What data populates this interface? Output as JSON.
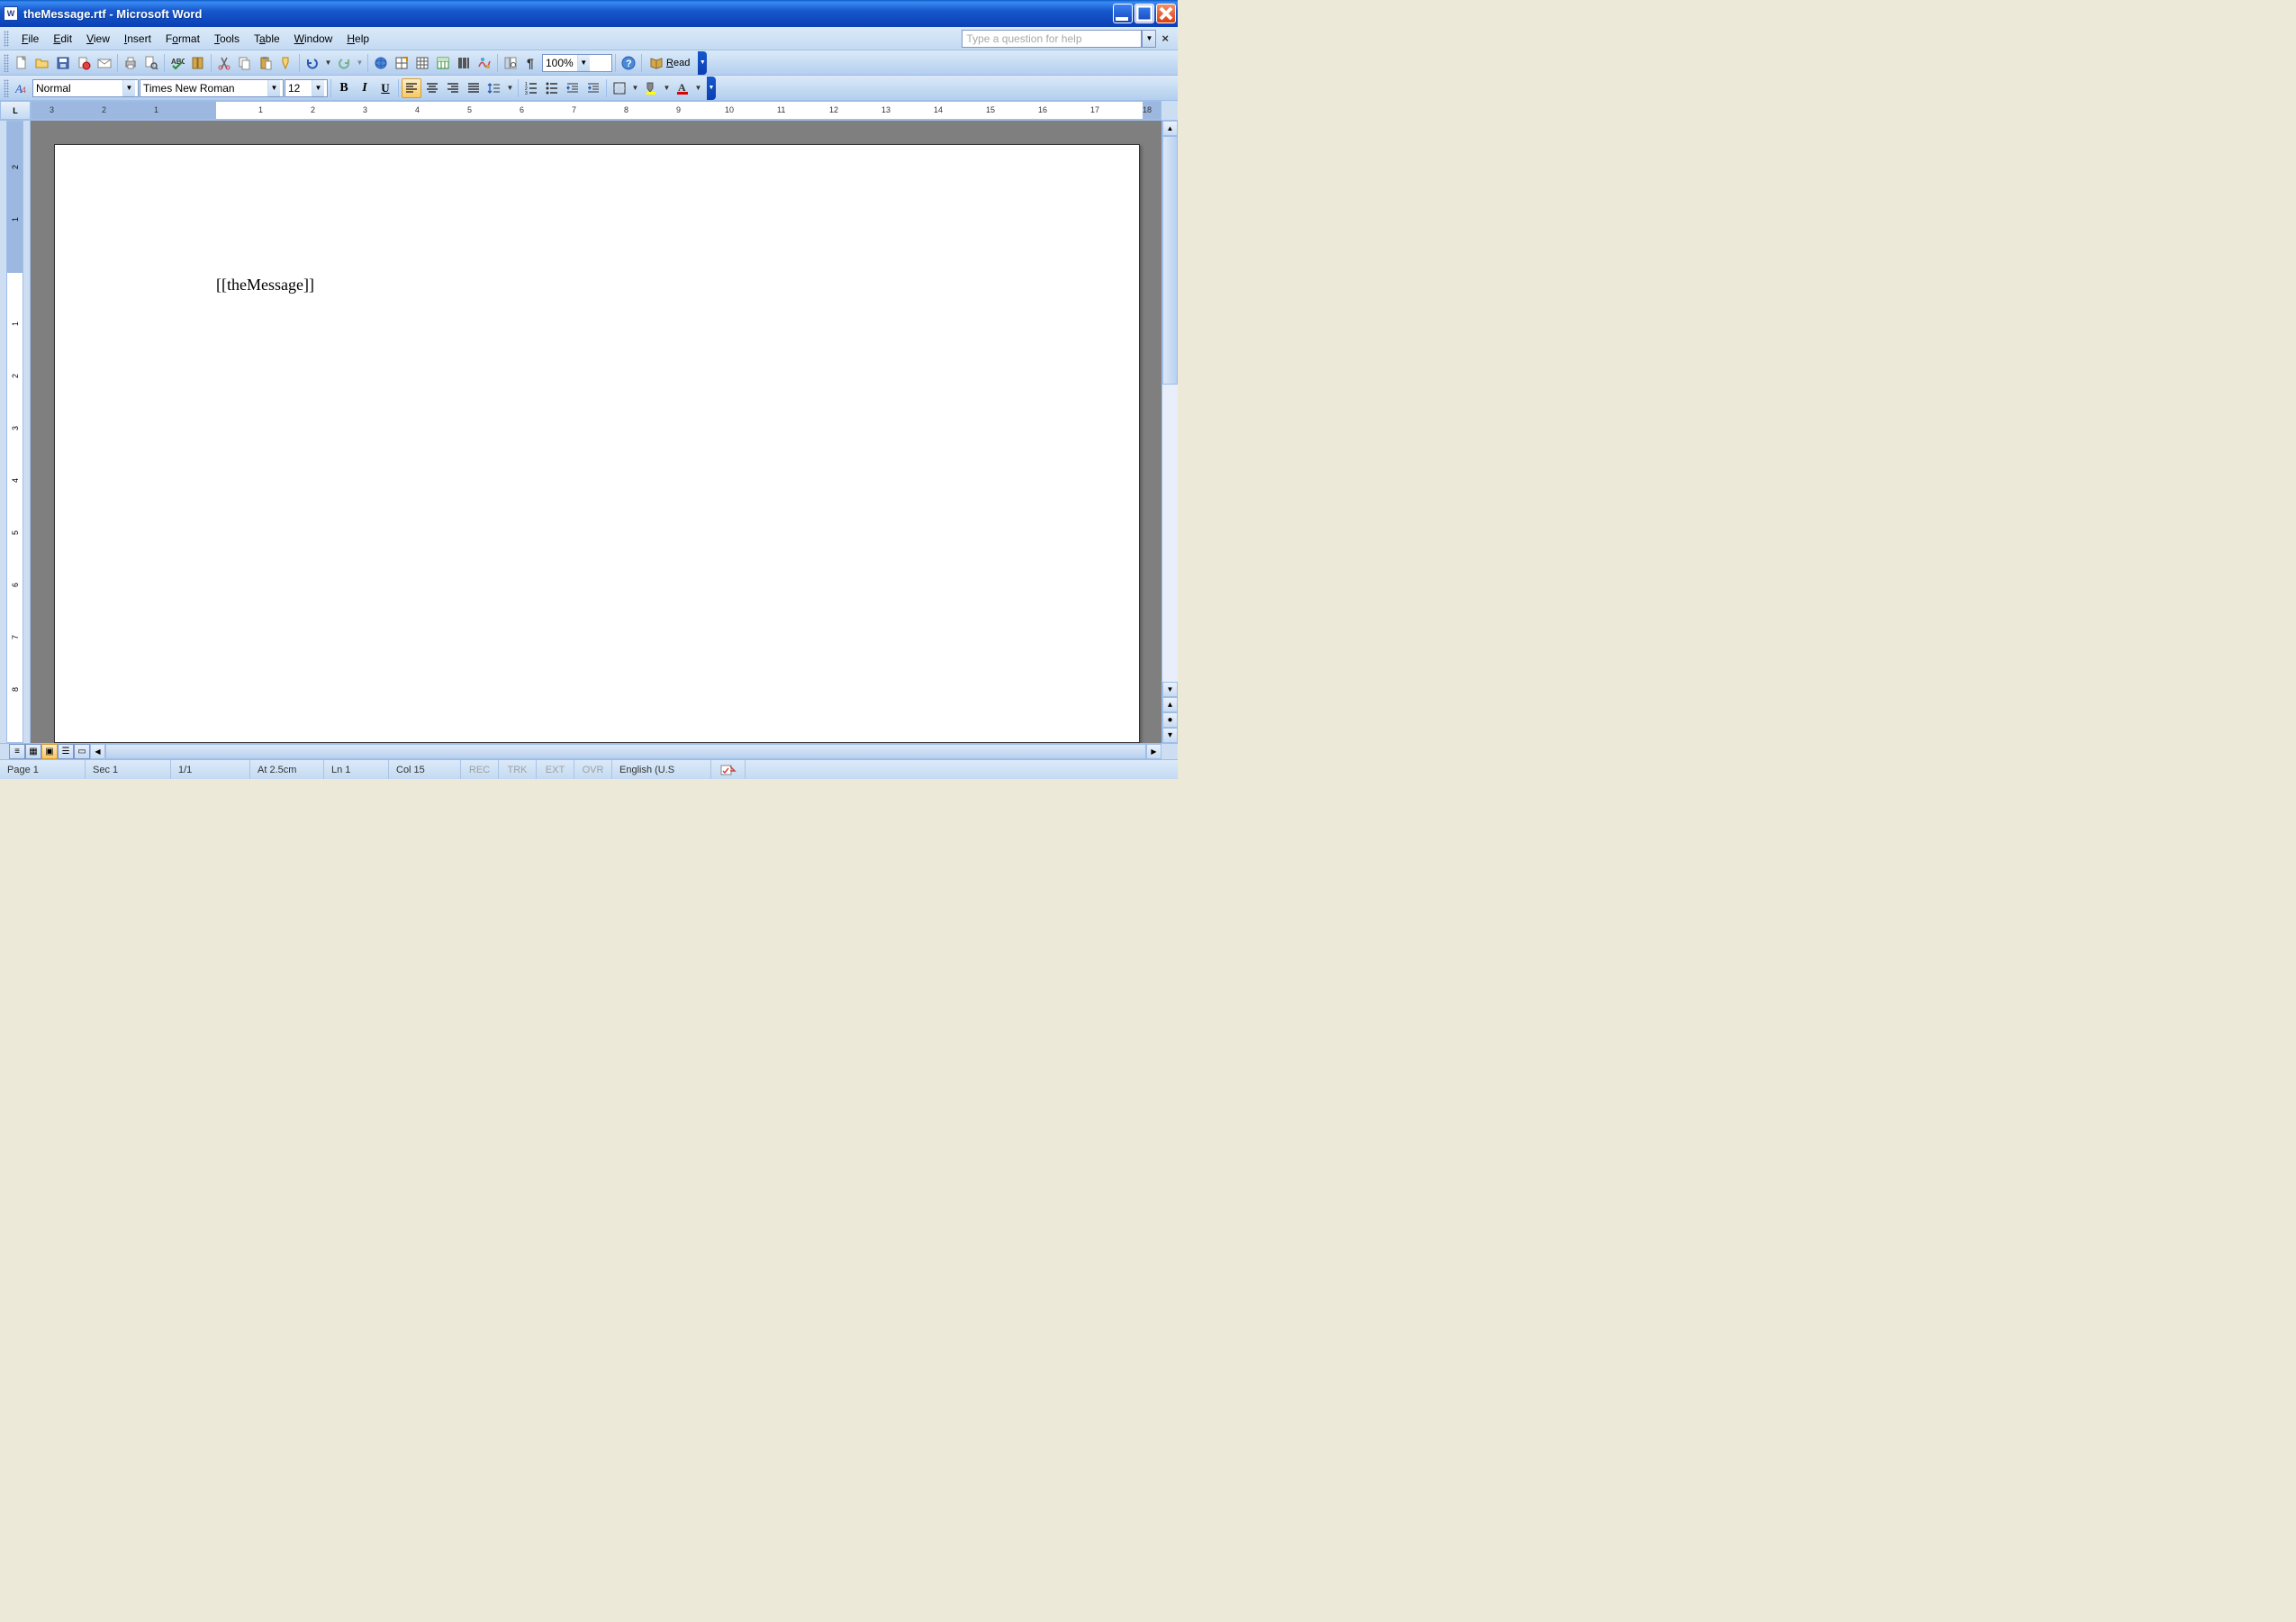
{
  "title": "theMessage.rtf - Microsoft Word",
  "menu": {
    "file": "File",
    "edit": "Edit",
    "view": "View",
    "insert": "Insert",
    "format": "Format",
    "tools": "Tools",
    "table": "Table",
    "window": "Window",
    "help": "Help"
  },
  "helpbox": {
    "placeholder": "Type a question for help"
  },
  "toolbar1": {
    "zoom": "100%",
    "read": "Read"
  },
  "toolbar2": {
    "style": "Normal",
    "font": "Times New Roman",
    "size": "12"
  },
  "ruler_corner": "L",
  "document": {
    "content": "[[theMessage]]"
  },
  "status": {
    "page": "Page  1",
    "sec": "Sec 1",
    "pages": "1/1",
    "at": "At  2.5cm",
    "ln": "Ln  1",
    "col": "Col  15",
    "rec": "REC",
    "trk": "TRK",
    "ext": "EXT",
    "ovr": "OVR",
    "lang": "English (U.S"
  }
}
